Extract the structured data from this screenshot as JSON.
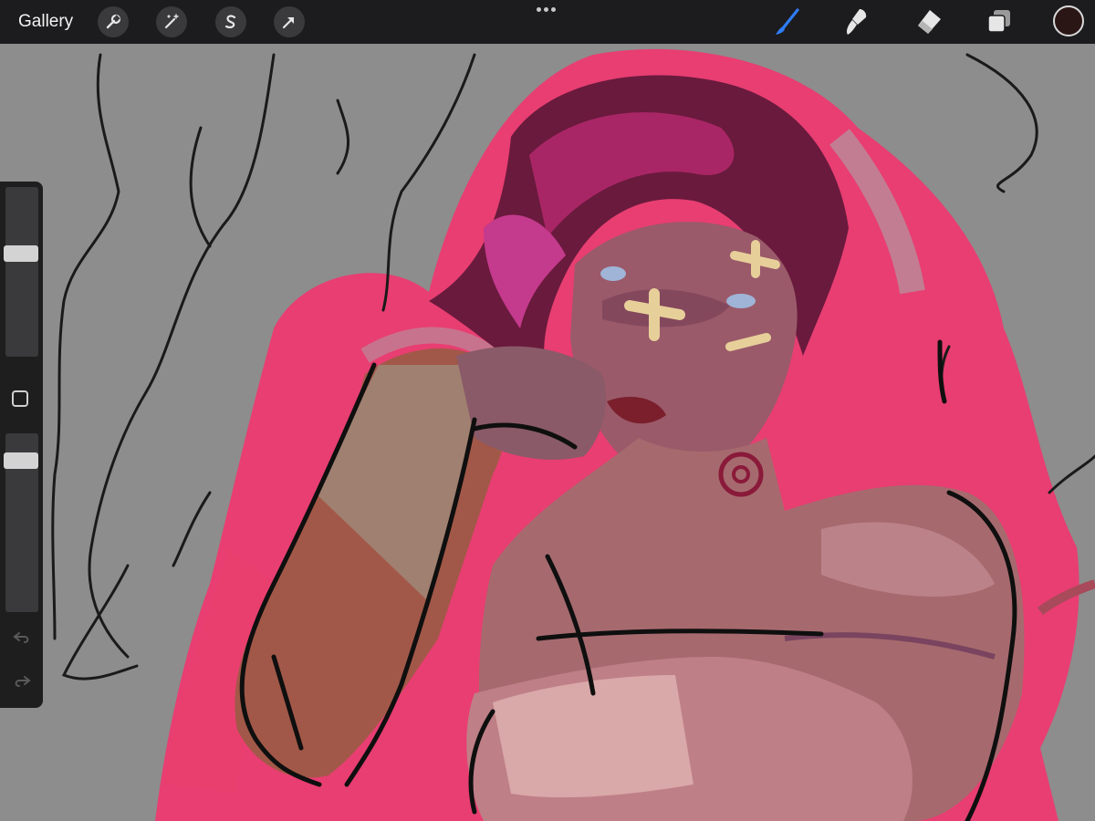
{
  "toolbar": {
    "gallery_label": "Gallery",
    "left_tools": [
      "wrench-icon",
      "magic-wand-icon",
      "selection-s-icon",
      "transform-arrow-icon"
    ],
    "right_tools": [
      "brush-icon",
      "smudge-icon",
      "eraser-icon",
      "layers-icon"
    ],
    "active_tool": "brush-icon",
    "active_color": "#2b1616",
    "accent_color": "#2f7cf6"
  },
  "sidebar": {
    "brush_size_level": 0.62,
    "brush_opacity_level": 0.88,
    "buttons": [
      "modify-square-icon",
      "undo-icon",
      "redo-icon"
    ]
  },
  "canvas": {
    "background_color": "#8d8d8d",
    "highlight_color": "#f2356f"
  }
}
